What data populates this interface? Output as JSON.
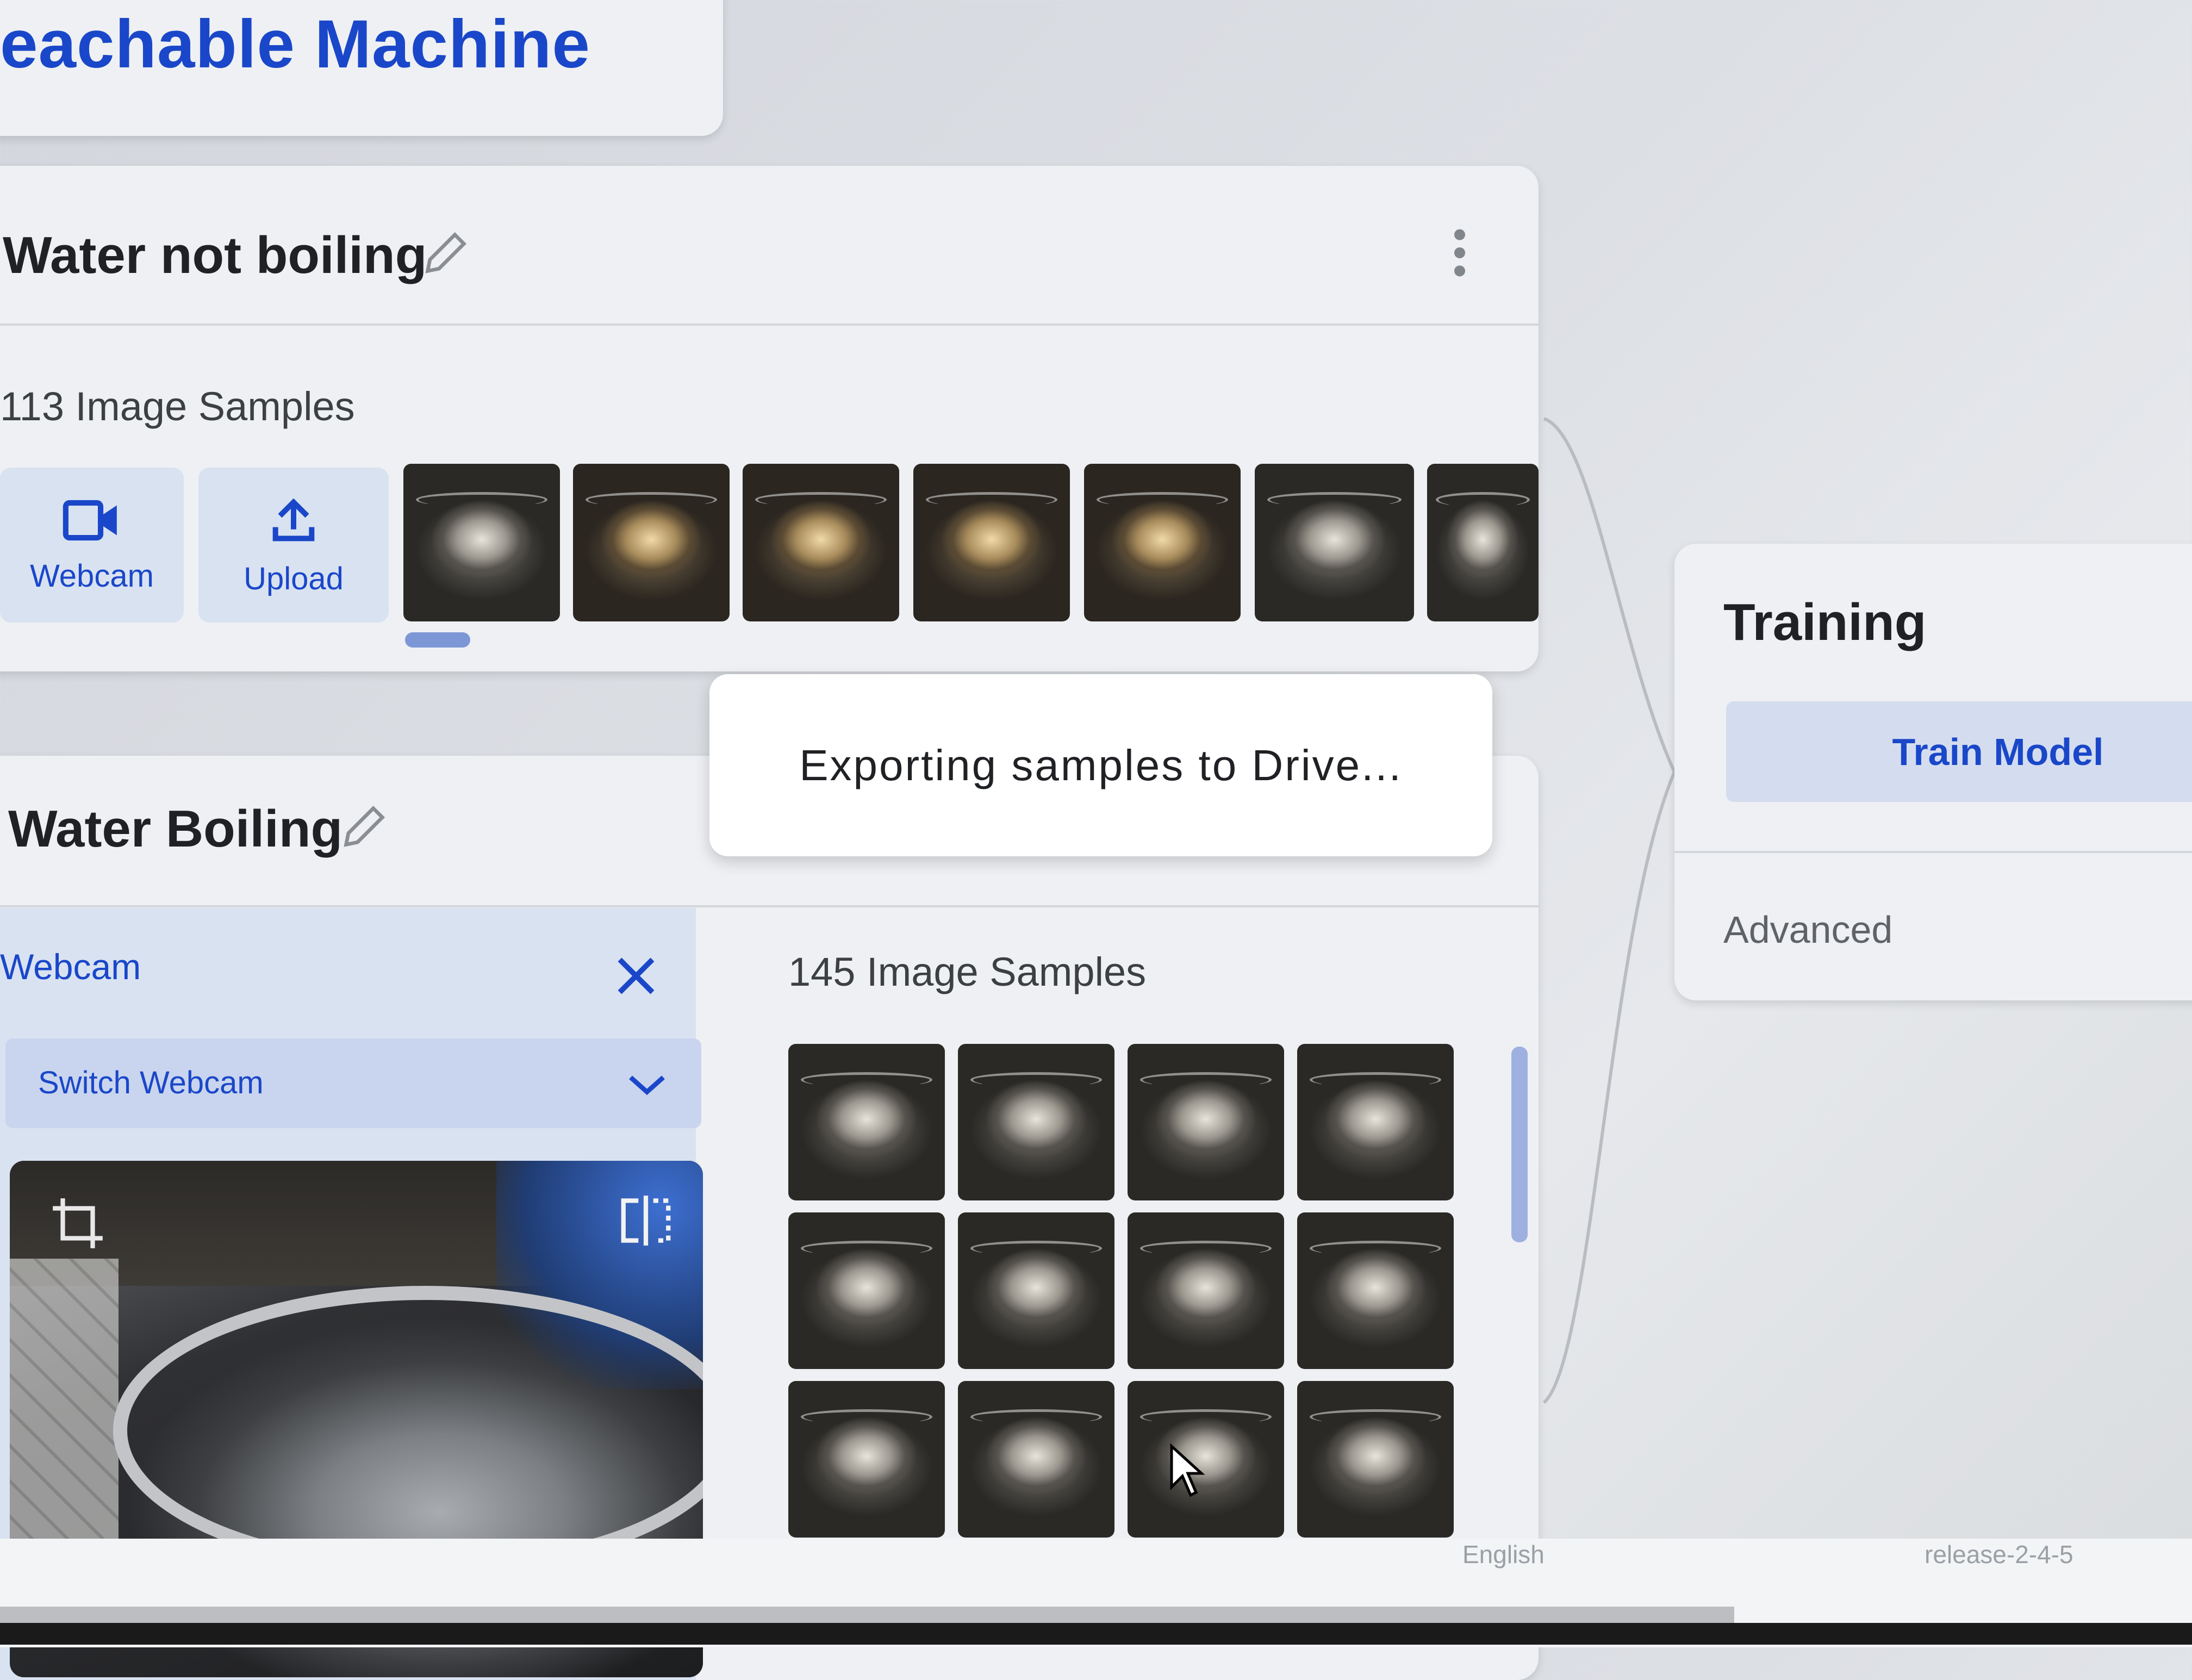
{
  "app": {
    "title": "eachable Machine"
  },
  "class1": {
    "name": "Water not boiling",
    "sample_count": "113 Image Samples",
    "webcam_label": "Webcam",
    "upload_label": "Upload"
  },
  "class2": {
    "name": "Water Boiling",
    "webcam_panel_title": "Webcam",
    "switch_webcam_label": "Switch Webcam",
    "sample_count": "145 Image Samples"
  },
  "toast": {
    "text": "Exporting samples to Drive..."
  },
  "training": {
    "title": "Training",
    "train_button": "Train Model",
    "advanced_label": "Advanced"
  },
  "footer": {
    "language": "English",
    "release": "release-2-4-5"
  },
  "colors": {
    "accent": "#1a47c9",
    "card_bg": "#eef0f3",
    "button_bg": "#d9e2f1"
  }
}
